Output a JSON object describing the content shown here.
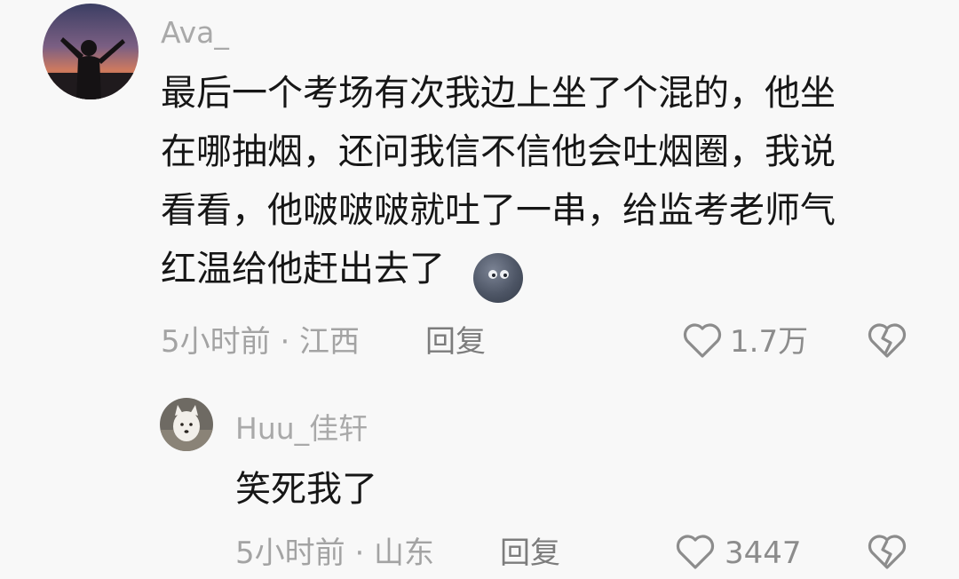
{
  "comments": [
    {
      "username": "Ava_",
      "text": "最后一个考场有次我边上坐了个混的，他坐\n在哪抽烟，还问我信不信他会吐烟圈，我说\n看看，他啵啵啵就吐了一串，给监考老师气\n红温给他赶出去了",
      "emoji": "ghost-emoji",
      "meta": "5小时前 · 江西",
      "reply_label": "回复",
      "likes": "1.7万"
    },
    {
      "username": "Huu_佳轩",
      "text": "笑死我了",
      "meta": "5小时前 · 山东",
      "reply_label": "回复",
      "likes": "3447"
    }
  ],
  "icons": {
    "like": "heart-outline-icon",
    "dislike": "broken-heart-icon"
  },
  "colors": {
    "background": "#f8f8f8",
    "text": "#161616",
    "secondary": "#a3a3a3",
    "icon": "#8c8c8c"
  }
}
